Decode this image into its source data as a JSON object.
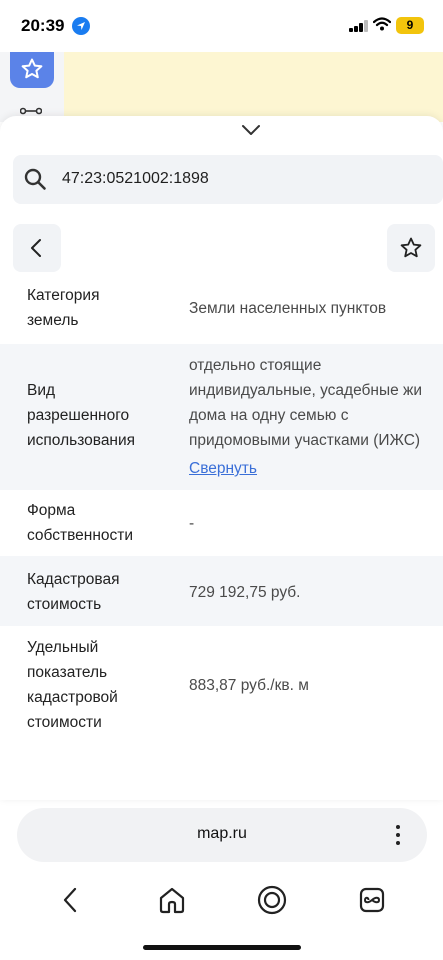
{
  "status_bar": {
    "time": "20:39",
    "battery": "9"
  },
  "search": {
    "value": "47:23:0521002:1898"
  },
  "details": [
    {
      "label": "Категория\nземель",
      "value_lines": [
        "Земли населенных пунктов"
      ]
    },
    {
      "label": "Вид\nразрешенного\nиспользования",
      "value_lines": [
        "отдельно стоящие",
        "индивидуальные, усадебные жи",
        "дома на одну семью с",
        "придомовыми участками (ИЖС)"
      ],
      "link": "Свернуть"
    },
    {
      "label": "Форма\nсобственности",
      "value_lines": [
        "-"
      ]
    },
    {
      "label": "Кадастровая\nстоимость",
      "value_lines": [
        "729 192,75 руб."
      ]
    },
    {
      "label": "Удельный\nпоказатель\nкадастровой\nстоимости",
      "value_lines": [
        "883,87 руб./кв. м"
      ]
    }
  ],
  "browser": {
    "url": "map.ru"
  },
  "icons": [
    "location-arrow-icon",
    "signal-icon",
    "wifi-icon",
    "star-icon",
    "route-icon",
    "chevron-down-icon",
    "search-icon",
    "back-arrow-icon",
    "favorite-star-icon",
    "menu-dots-icon",
    "nav-back-icon",
    "home-icon",
    "alice-icon",
    "tabs-icon"
  ],
  "colors": {
    "accent": "#3a6fd8",
    "star_button": "#5b83e8",
    "battery": "#f2c40c",
    "map": "#fdf6d2"
  }
}
